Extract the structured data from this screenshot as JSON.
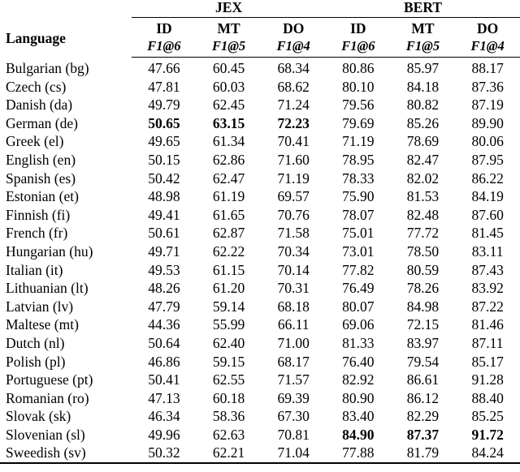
{
  "table": {
    "groups": [
      {
        "label": "JEX",
        "span": 3
      },
      {
        "label": "BERT",
        "span": 3
      }
    ],
    "row_header": "Language",
    "metric_names": [
      "ID",
      "MT",
      "DO",
      "ID",
      "MT",
      "DO"
    ],
    "metric_subheads": [
      "F1@6",
      "F1@5",
      "F1@4",
      "F1@6",
      "F1@5",
      "F1@4"
    ],
    "rows": [
      {
        "language": "Bulgarian (bg)",
        "values": [
          "47.66",
          "60.45",
          "68.34",
          "80.86",
          "85.97",
          "88.17"
        ],
        "bold": []
      },
      {
        "language": "Czech (cs)",
        "values": [
          "47.81",
          "60.03",
          "68.62",
          "80.10",
          "84.18",
          "87.36"
        ],
        "bold": []
      },
      {
        "language": "Danish (da)",
        "values": [
          "49.79",
          "62.45",
          "71.24",
          "79.56",
          "80.82",
          "87.19"
        ],
        "bold": []
      },
      {
        "language": "German (de)",
        "values": [
          "50.65",
          "63.15",
          "72.23",
          "79.69",
          "85.26",
          "89.90"
        ],
        "bold": [
          0,
          1,
          2
        ]
      },
      {
        "language": "Greek (el)",
        "values": [
          "49.65",
          "61.34",
          "70.41",
          "71.19",
          "78.69",
          "80.06"
        ],
        "bold": []
      },
      {
        "language": "English (en)",
        "values": [
          "50.15",
          "62.86",
          "71.60",
          "78.95",
          "82.47",
          "87.95"
        ],
        "bold": []
      },
      {
        "language": "Spanish (es)",
        "values": [
          "50.42",
          "62.47",
          "71.19",
          "78.33",
          "82.02",
          "86.22"
        ],
        "bold": []
      },
      {
        "language": "Estonian (et)",
        "values": [
          "48.98",
          "61.19",
          "69.57",
          "75.90",
          "81.53",
          "84.19"
        ],
        "bold": []
      },
      {
        "language": "Finnish (fi)",
        "values": [
          "49.41",
          "61.65",
          "70.76",
          "78.07",
          "82.48",
          "87.60"
        ],
        "bold": []
      },
      {
        "language": "French (fr)",
        "values": [
          "50.61",
          "62.87",
          "71.58",
          "75.01",
          "77.72",
          "81.45"
        ],
        "bold": []
      },
      {
        "language": "Hungarian (hu)",
        "values": [
          "49.71",
          "62.22",
          "70.34",
          "73.01",
          "78.50",
          "83.11"
        ],
        "bold": []
      },
      {
        "language": "Italian (it)",
        "values": [
          "49.53",
          "61.15",
          "70.14",
          "77.82",
          "80.59",
          "87.43"
        ],
        "bold": []
      },
      {
        "language": "Lithuanian (lt)",
        "values": [
          "48.26",
          "61.20",
          "70.31",
          "76.49",
          "78.26",
          "83.92"
        ],
        "bold": []
      },
      {
        "language": "Latvian (lv)",
        "values": [
          "47.79",
          "59.14",
          "68.18",
          "80.07",
          "84.98",
          "87.22"
        ],
        "bold": []
      },
      {
        "language": "Maltese (mt)",
        "values": [
          "44.36",
          "55.99",
          "66.11",
          "69.06",
          "72.15",
          "81.46"
        ],
        "bold": []
      },
      {
        "language": "Dutch (nl)",
        "values": [
          "50.64",
          "62.40",
          "71.00",
          "81.33",
          "83.97",
          "87.11"
        ],
        "bold": []
      },
      {
        "language": "Polish (pl)",
        "values": [
          "46.86",
          "59.15",
          "68.17",
          "76.40",
          "79.54",
          "85.17"
        ],
        "bold": []
      },
      {
        "language": "Portuguese (pt)",
        "values": [
          "50.41",
          "62.55",
          "71.57",
          "82.92",
          "86.61",
          "91.28"
        ],
        "bold": []
      },
      {
        "language": "Romanian (ro)",
        "values": [
          "47.13",
          "60.18",
          "69.39",
          "80.90",
          "86.12",
          "88.40"
        ],
        "bold": []
      },
      {
        "language": "Slovak (sk)",
        "values": [
          "46.34",
          "58.36",
          "67.30",
          "83.40",
          "82.29",
          "85.25"
        ],
        "bold": []
      },
      {
        "language": "Slovenian (sl)",
        "values": [
          "49.96",
          "62.63",
          "70.81",
          "84.90",
          "87.37",
          "91.72"
        ],
        "bold": [
          3,
          4,
          5
        ]
      },
      {
        "language": "Sweedish (sv)",
        "values": [
          "50.32",
          "62.21",
          "71.04",
          "77.88",
          "81.79",
          "84.24"
        ],
        "bold": []
      }
    ]
  }
}
